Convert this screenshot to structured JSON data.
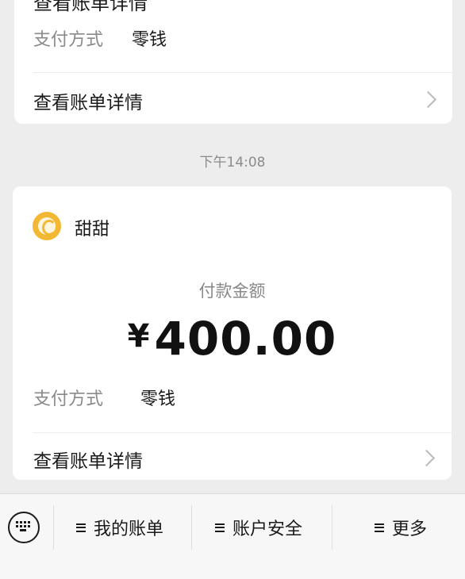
{
  "top_card": {
    "cut_title": "查看账单详情",
    "payment_method_label": "支付方式",
    "payment_method_value": "零钱",
    "view_detail": "查看账单详情"
  },
  "timestamp": "下午14:08",
  "main_card": {
    "sender": "甜甜",
    "amount_label": "付款金额",
    "currency": "¥",
    "amount": "400.00",
    "payment_method_label": "支付方式",
    "payment_method_value": "零钱",
    "view_detail": "查看账单详情"
  },
  "bottom_menu": {
    "items": [
      {
        "label": "我的账单"
      },
      {
        "label": "账户安全"
      },
      {
        "label": "更多"
      }
    ]
  },
  "colors": {
    "background": "#ededed",
    "card": "#ffffff",
    "avatar": "#f3b833"
  }
}
